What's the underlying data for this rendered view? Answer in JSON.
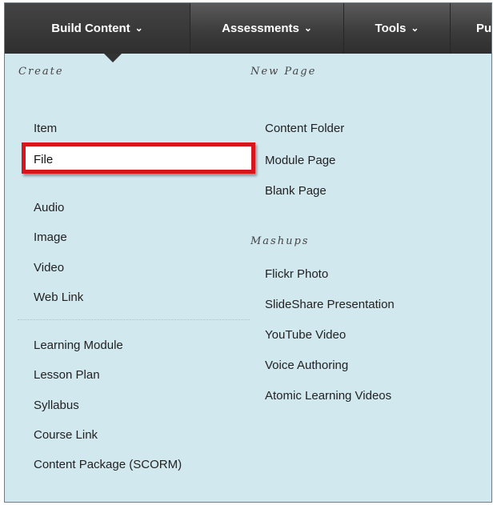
{
  "nav": {
    "tabs": [
      {
        "label": "Build Content"
      },
      {
        "label": "Assessments"
      },
      {
        "label": "Tools"
      },
      {
        "label": "Pu"
      }
    ]
  },
  "menu": {
    "create": {
      "heading": "Create",
      "items": [
        "Item",
        "File",
        "Audio",
        "Image",
        "Video",
        "Web Link"
      ],
      "more_items": [
        "Learning Module",
        "Lesson Plan",
        "Syllabus",
        "Course Link",
        "Content Package (SCORM)"
      ]
    },
    "new_page": {
      "heading": "New Page",
      "items": [
        "Content Folder",
        "Module Page",
        "Blank Page"
      ]
    },
    "mashups": {
      "heading": "Mashups",
      "items": [
        "Flickr Photo",
        "SlideShare Presentation",
        "YouTube Video",
        "Voice Authoring",
        "Atomic Learning Videos"
      ]
    }
  },
  "highlight": {
    "color": "#d8141c",
    "target": "File"
  },
  "colors": {
    "menu_bg": "#d1e8ef",
    "nav_bg": "#3c3c3c"
  }
}
